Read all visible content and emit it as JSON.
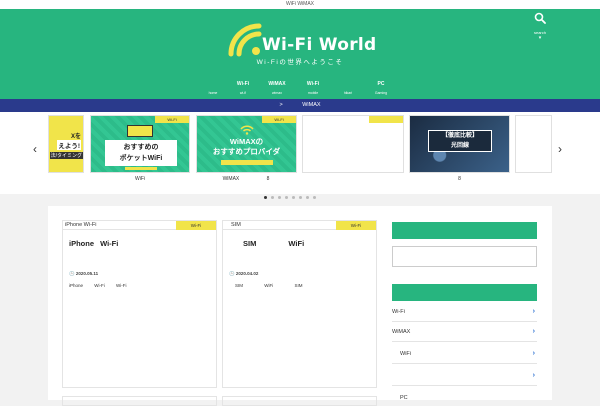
{
  "topbar": {
    "text": "WiFi WiMAX"
  },
  "header": {
    "logo_text": "Wi-Fi World",
    "tagline": "Wi-Fiの世界へようこそ",
    "search_label": "search",
    "brand_color": "#27b57f"
  },
  "nav": {
    "items": [
      {
        "jp": "",
        "en": "home"
      },
      {
        "jp": "Wi-Fi",
        "en": "wi-fi"
      },
      {
        "jp": "WiMAX",
        "en": "wimax"
      },
      {
        "jp": "Wi-Fi",
        "en": "mobile"
      },
      {
        "jp": "",
        "en": "hikari"
      },
      {
        "jp": "PC",
        "en": "Gaming"
      }
    ]
  },
  "breadcrumb": {
    "sep": ">",
    "current": "WiMAX"
  },
  "slider": {
    "slides": [
      {
        "text1": "Xを",
        "text2": "えよう!",
        "text3": "法/タイミング",
        "caption": ""
      },
      {
        "tag": "Wi-Fi",
        "line1": "おすすめの",
        "line2": "ポケットWiFi",
        "caption": "WiFi"
      },
      {
        "tag": "Wi-Fi",
        "line1": "WiMAXの",
        "line2": "おすすめプロバイダ",
        "caption": "WiMAX 8"
      },
      {
        "tag": "",
        "caption": ""
      },
      {
        "tag": "",
        "line1": "【徹底比較】",
        "line2": "光回線",
        "caption": "8"
      }
    ],
    "dots": 8,
    "active_dot": 0
  },
  "articles": [
    {
      "category": "iPhone Wi-Fi",
      "tag": "Wi-Fi",
      "title": "iPhone Wi-Fi",
      "date": "2020.05.11",
      "excerpt": "iPhone Wi-Fi Wi-Fi"
    },
    {
      "category": "SIM",
      "tag": "Wi-Fi",
      "title": "SIM WiFi",
      "date": "2020.04.02",
      "excerpt": "SIM WiFi SIM"
    }
  ],
  "sidebar": {
    "items": [
      {
        "label": "Wi-Fi"
      },
      {
        "label": "WiMAX"
      },
      {
        "label": "WiFi"
      },
      {
        "label": ""
      },
      {
        "label": "PC"
      }
    ]
  }
}
